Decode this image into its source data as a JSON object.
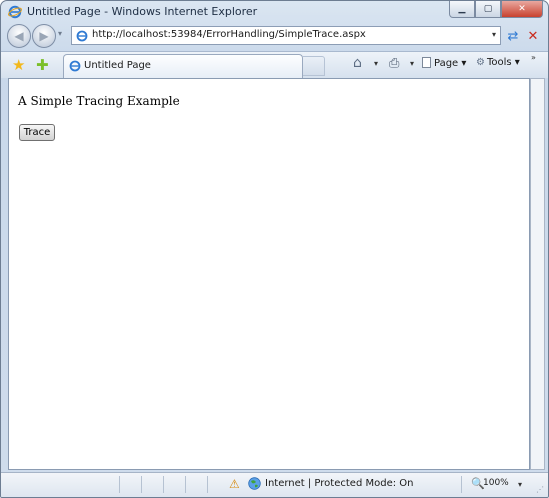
{
  "window": {
    "title": "Untitled Page - Windows Internet Explorer",
    "minimize_glyph": "▁",
    "maximize_glyph": "▢",
    "close_glyph": "✕"
  },
  "navigation": {
    "back_glyph": "◀",
    "forward_glyph": "▶",
    "dropdown_glyph": "▾",
    "address": "http://localhost:53984/ErrorHandling/SimpleTrace.aspx",
    "refresh_glyph": "⇄",
    "stop_glyph": "✕"
  },
  "command_bar": {
    "favorites_glyph": "★",
    "add_favorite_glyph": "✚",
    "tab_label": "Untitled Page",
    "home_glyph": "⌂",
    "print_glyph": "⎙",
    "dropdown_glyph": "▾",
    "page_menu": "Page",
    "tools_menu": "Tools",
    "tools_glyph": "⚙",
    "overflow_glyph": "»"
  },
  "page": {
    "heading": "A Simple Tracing Example",
    "trace_button": "Trace"
  },
  "status_bar": {
    "warning_glyph": "⚠",
    "zone": "Internet | Protected Mode: On",
    "zoom_glyph": "🔍",
    "zoom": "100%",
    "dropdown_glyph": "▾",
    "grip_glyph": "⋰"
  },
  "icons": {
    "ie_logo": "ie-logo-icon",
    "globe": "globe-icon",
    "colors": {
      "ie_blue": "#2f7ad3",
      "accent_gold": "#f2b81c",
      "close_red": "#c8412e"
    }
  }
}
